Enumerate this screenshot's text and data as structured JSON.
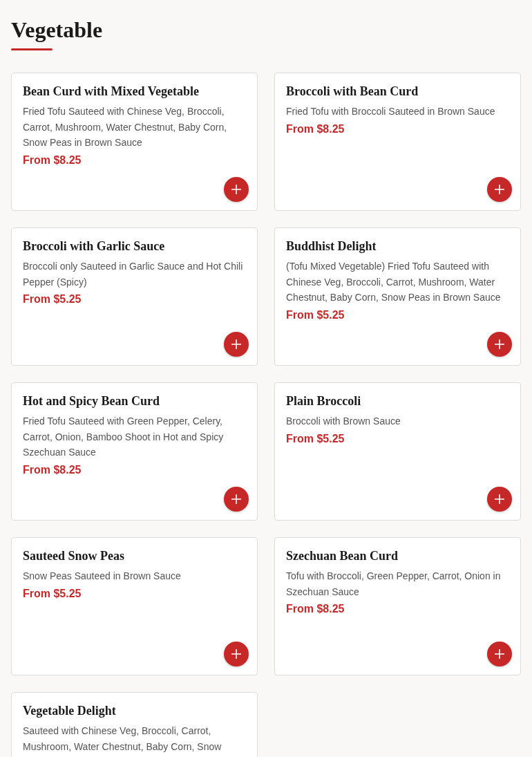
{
  "section": {
    "title": "Vegetable"
  },
  "items": [
    {
      "name": "Bean Curd with Mixed Vegetable",
      "description": "Fried Tofu Sauteed with Chinese Veg, Broccoli, Carrot, Mushroom, Water Chestnut, Baby Corn, Snow Peas in Brown Sauce",
      "price": "From $8.25"
    },
    {
      "name": "Broccoli with Bean Curd",
      "description": "Fried Tofu with Broccoli Sauteed in Brown Sauce",
      "price": "From $8.25"
    },
    {
      "name": "Broccoli with Garlic Sauce",
      "description": "Broccoli only Sauteed in Garlic Sauce and Hot Chili Pepper (Spicy)",
      "price": "From $5.25"
    },
    {
      "name": "Buddhist Delight",
      "description": "(Tofu Mixed Vegetable) Fried Tofu Sauteed with Chinese Veg, Broccoli, Carrot, Mushroom, Water Chestnut, Baby Corn, Snow Peas in Brown Sauce",
      "price": "From $5.25"
    },
    {
      "name": "Hot and Spicy Bean Curd",
      "description": "Fried Tofu Sauteed with Green Pepper, Celery, Carrot, Onion, Bamboo Shoot in Hot and Spicy Szechuan Sauce",
      "price": "From $8.25"
    },
    {
      "name": "Plain Broccoli",
      "description": "Broccoli with Brown Sauce",
      "price": "From $5.25"
    },
    {
      "name": "Sauteed Snow Peas",
      "description": "Snow Peas Sauteed in Brown Sauce",
      "price": "From $5.25"
    },
    {
      "name": "Szechuan Bean Curd",
      "description": "Tofu with Broccoli, Green Pepper, Carrot, Onion in Szechuan Sauce",
      "price": "From $8.25"
    },
    {
      "name": "Vegetable Delight",
      "description": "Sauteed with Chinese Veg, Broccoli, Carrot, Mushroom, Water Chestnut, Baby Corn, Snow"
    }
  ]
}
